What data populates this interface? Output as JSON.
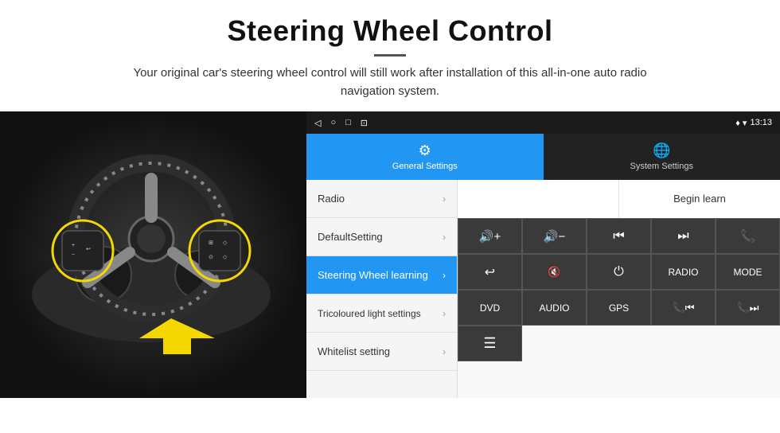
{
  "header": {
    "title": "Steering Wheel Control",
    "subtitle": "Your original car's steering wheel control will still work after installation of this all-in-one auto radio navigation system."
  },
  "status_bar": {
    "nav_icons": [
      "◁",
      "○",
      "□",
      "⊡"
    ],
    "right_icons": "♦ ▾",
    "time": "13:13"
  },
  "tabs": [
    {
      "id": "general",
      "label": "General Settings",
      "icon": "⚙",
      "active": true
    },
    {
      "id": "system",
      "label": "System Settings",
      "icon": "🌐",
      "active": false
    }
  ],
  "menu_items": [
    {
      "label": "Radio",
      "active": false
    },
    {
      "label": "DefaultSetting",
      "active": false
    },
    {
      "label": "Steering Wheel learning",
      "active": true
    },
    {
      "label": "Tricoloured light settings",
      "active": false
    },
    {
      "label": "Whitelist setting",
      "active": false
    }
  ],
  "begin_learn_label": "Begin learn",
  "control_buttons": {
    "row1": [
      {
        "label": "🔊+",
        "type": "icon"
      },
      {
        "label": "🔊−",
        "type": "icon"
      },
      {
        "label": "⏮",
        "type": "icon"
      },
      {
        "label": "⏭",
        "type": "icon"
      },
      {
        "label": "📞",
        "type": "icon"
      }
    ],
    "row2": [
      {
        "label": "↩",
        "type": "icon"
      },
      {
        "label": "🔊×",
        "type": "icon"
      },
      {
        "label": "⏻",
        "type": "icon"
      },
      {
        "label": "RADIO",
        "type": "text"
      },
      {
        "label": "MODE",
        "type": "text"
      }
    ],
    "row3": [
      {
        "label": "DVD",
        "type": "text"
      },
      {
        "label": "AUDIO",
        "type": "text"
      },
      {
        "label": "GPS",
        "type": "text"
      },
      {
        "label": "📞⏮",
        "type": "icon"
      },
      {
        "label": "📞⏭",
        "type": "icon"
      }
    ],
    "row4": [
      {
        "label": "≡",
        "type": "icon"
      }
    ]
  }
}
